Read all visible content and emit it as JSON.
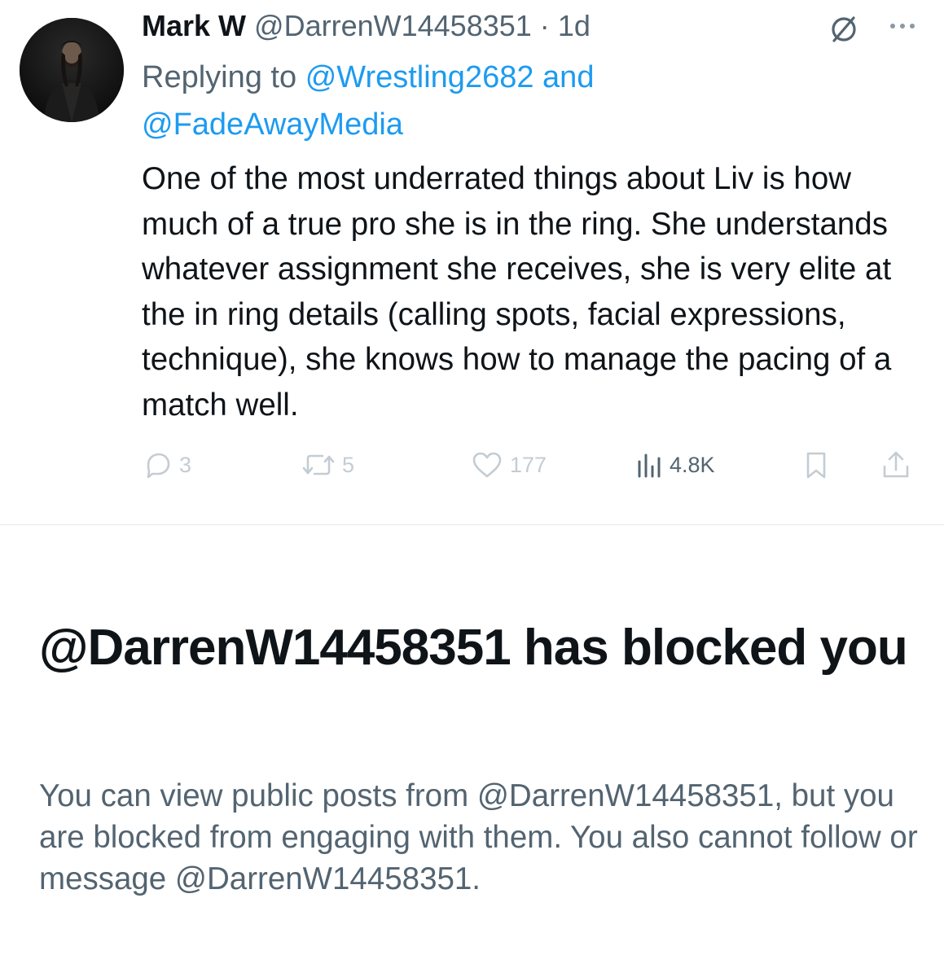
{
  "tweet": {
    "author": {
      "display_name": "Mark W",
      "handle": "@DarrenW14458351",
      "separator": "·",
      "time": "1d",
      "avatar_icon": "profile-photo"
    },
    "reply": {
      "prefix": "Replying to",
      "mention_1": "@Wrestling2682",
      "conjunction": "and",
      "mention_2": "@FadeAwayMedia"
    },
    "text": "One of the most underrated things about Liv is how much of a true pro she is in the ring. She understands whatever assignment she receives, she is very elite at the in ring details (calling spots, facial expressions, technique), she knows how to manage the pacing of a match well.",
    "header_icons": [
      "grok-slash-icon",
      "more-icon"
    ],
    "actions": {
      "reply_count": "3",
      "repost_count": "5",
      "like_count": "177",
      "views_count": "4.8K",
      "icons": [
        "reply-icon",
        "repost-icon",
        "like-icon",
        "views-icon",
        "bookmark-icon",
        "share-icon"
      ]
    }
  },
  "blocked": {
    "title": "@DarrenW14458351 has blocked you",
    "description": "You can view public posts from @DarrenW14458351, but you are blocked from engaging with them. You also cannot follow or message @DarrenW14458351."
  },
  "colors": {
    "text_primary": "#0f1419",
    "text_secondary": "#536471",
    "link": "#1d9bf0",
    "action_muted": "#c4ccd3",
    "divider": "#e6e9ec"
  }
}
